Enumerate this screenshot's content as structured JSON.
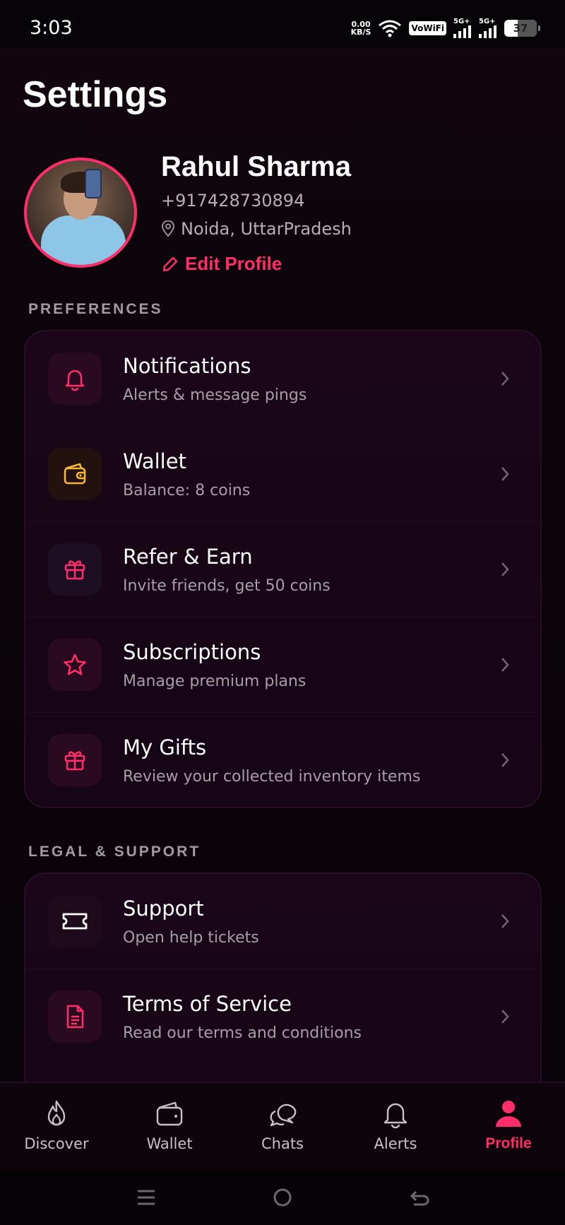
{
  "status_bar": {
    "time": "3:03",
    "net_speed_value": "0.00",
    "net_speed_unit": "KB/S",
    "vowifi": "VoWiFi",
    "signal1_label": "5G+",
    "signal2_label": "5G+",
    "battery": "37"
  },
  "header": {
    "title": "Settings"
  },
  "profile": {
    "name": "Rahul Sharma",
    "phone": "+917428730894",
    "location": "Noida, UttarPradesh",
    "edit_label": "Edit Profile"
  },
  "sections": [
    {
      "heading": "PREFERENCES",
      "items": [
        {
          "title": "Notifications",
          "subtitle": "Alerts & message pings",
          "icon": "bell-icon",
          "icon_color": "#ff2d6a"
        },
        {
          "title": "Wallet",
          "subtitle": "Balance: 8 coins",
          "icon": "wallet-icon",
          "icon_color": "#f5b731"
        },
        {
          "title": "Refer & Earn",
          "subtitle": "Invite friends, get 50 coins",
          "icon": "gift-icon",
          "icon_color": "#ff2d6a"
        },
        {
          "title": "Subscriptions",
          "subtitle": "Manage premium plans",
          "icon": "star-icon",
          "icon_color": "#ff2d6a"
        },
        {
          "title": "My Gifts",
          "subtitle": "Review your collected inventory items",
          "icon": "gift-icon",
          "icon_color": "#ff2d6a"
        }
      ]
    },
    {
      "heading": "LEGAL & SUPPORT",
      "items": [
        {
          "title": "Support",
          "subtitle": "Open help tickets",
          "icon": "ticket-icon",
          "icon_color": "#ffffff"
        },
        {
          "title": "Terms of Service",
          "subtitle": "Read our terms and conditions",
          "icon": "document-icon",
          "icon_color": "#ff2d6a"
        }
      ]
    }
  ],
  "bottom_nav": [
    {
      "label": "Discover",
      "icon": "flame-icon"
    },
    {
      "label": "Wallet",
      "icon": "wallet-icon"
    },
    {
      "label": "Chats",
      "icon": "chat-icon"
    },
    {
      "label": "Alerts",
      "icon": "bell-icon"
    },
    {
      "label": "Profile",
      "icon": "person-icon",
      "active": true
    }
  ],
  "colors": {
    "accent": "#ff2d6a",
    "background": "#0c050b",
    "card": "#170617"
  }
}
